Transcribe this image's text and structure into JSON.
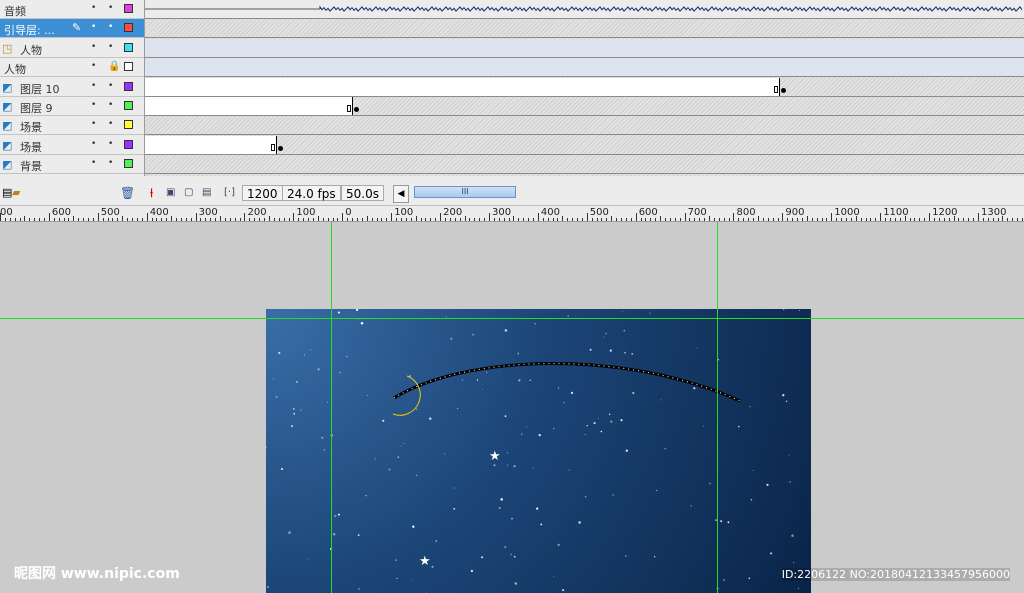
{
  "layers": [
    {
      "name": "音频",
      "color": "#e040e0",
      "icon": "none",
      "lock": false,
      "selected": false
    },
    {
      "name": "引导层: ...",
      "color": "#ff4a4a",
      "icon": "none",
      "lock": false,
      "selected": true
    },
    {
      "name": "人物",
      "color": "#40e0f0",
      "icon": "guide-icon",
      "lock": false,
      "selected": false
    },
    {
      "name": "人物",
      "color": "#ffffff",
      "icon": "none",
      "lock": true,
      "selected": false
    },
    {
      "name": "图层 10",
      "color": "#9933ff",
      "icon": "motion-layer-icon",
      "lock": false,
      "selected": false
    },
    {
      "name": "图层 9",
      "color": "#55ee55",
      "icon": "motion-layer-icon",
      "lock": false,
      "selected": false
    },
    {
      "name": "场景",
      "color": "#ffff40",
      "icon": "motion-layer-icon",
      "lock": false,
      "selected": false
    },
    {
      "name": "场景",
      "color": "#9933ff",
      "icon": "motion-layer-icon",
      "lock": false,
      "selected": false
    },
    {
      "name": "背景",
      "color": "#55ee55",
      "icon": "motion-layer-icon",
      "lock": false,
      "selected": false
    }
  ],
  "status": {
    "frame": "1200",
    "fps": "24.0 fps",
    "time": "50.0s",
    "scroll_glyph": "III"
  },
  "ruler": {
    "labels": [
      "00",
      "600",
      "500",
      "400",
      "300",
      "200",
      "100",
      "0",
      "100",
      "200",
      "300",
      "400",
      "500",
      "600",
      "700",
      "800",
      "900",
      "1000",
      "1100",
      "1200",
      "1300",
      "14"
    ]
  },
  "watermark": {
    "site": "昵图网 www.nipic.com",
    "id": "ID:2206122 NO:20180412133457956000"
  },
  "colors": {
    "stage_top": "#3a6ea8",
    "stage_bottom": "#0a2448",
    "guide": "#22dd22",
    "selected_layer": "#3d8fd6"
  }
}
